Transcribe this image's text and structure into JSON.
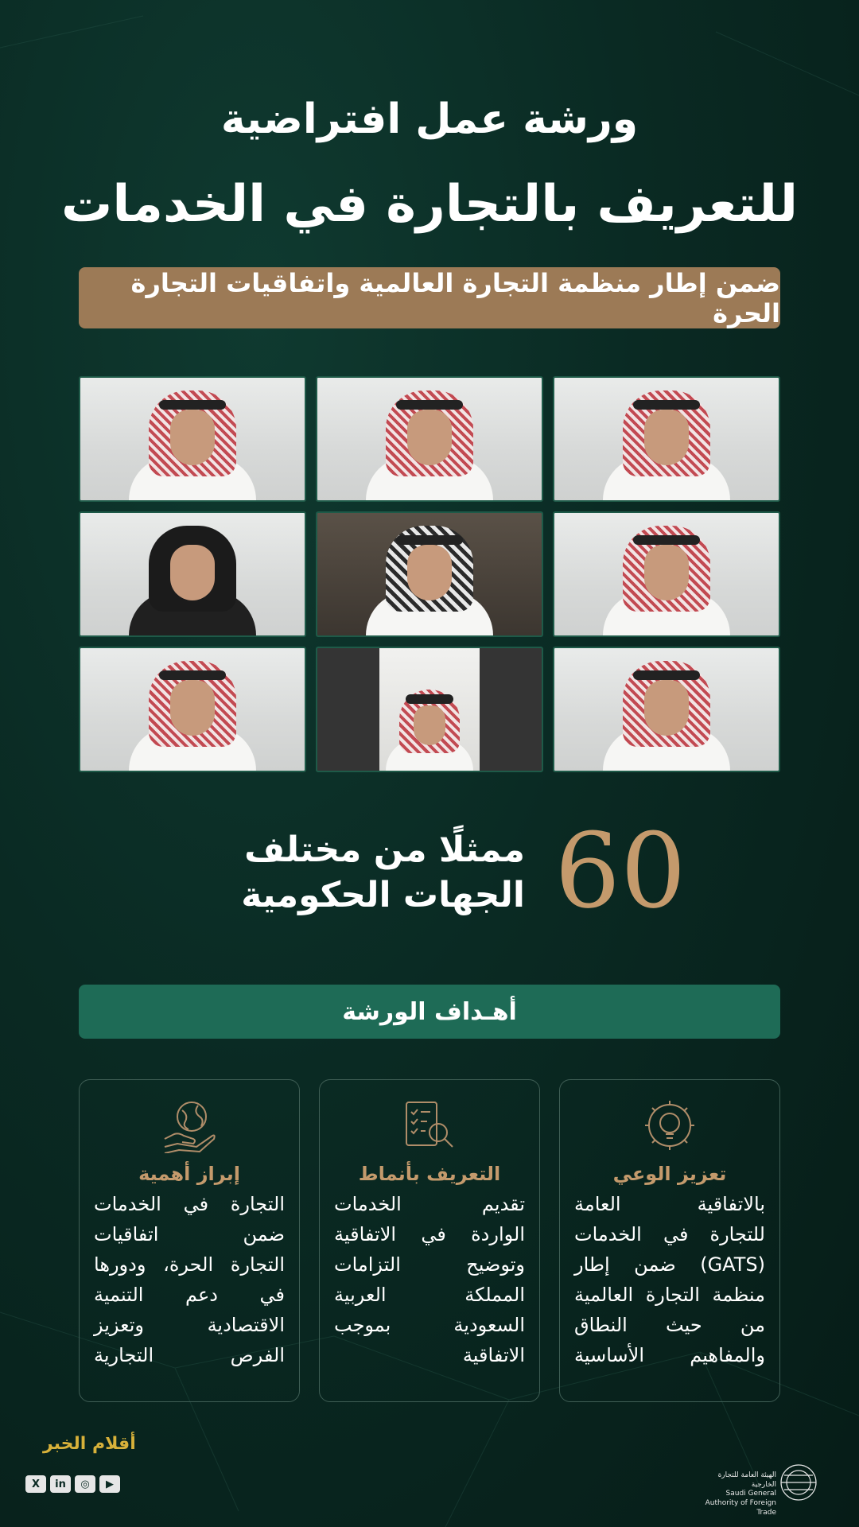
{
  "header": {
    "line1": "ورشة عمل افتراضية",
    "line2": "للتعريف بالتجارة في الخدمات",
    "subtitle": "ضمن إطار منظمة التجارة العالمية واتفاقيات التجارة الحرة"
  },
  "stat": {
    "number": "60",
    "line1": "ممثلًا من مختلف",
    "line2": "الجهات الحكومية"
  },
  "goals_title": "أهـداف الورشة",
  "cards": [
    {
      "icon": "lightbulb-gear-icon",
      "title": "تعزيز الوعي",
      "lines": [
        "بالاتفاقية العامة",
        "للتجارة في الخدمات",
        "(GATS) ضمن إطار",
        "منظمة التجارة العالمية",
        "من حيث النطاق",
        "والمفاهيم الأساسية"
      ]
    },
    {
      "icon": "checklist-search-icon",
      "title": "التعريف بأنماط",
      "lines": [
        "تقديم الخدمات",
        "الواردة في الاتفاقية",
        "وتوضيح التزامات",
        "المملكة العربية",
        "السعودية بموجب",
        "الاتفاقية"
      ]
    },
    {
      "icon": "globe-hand-icon",
      "title": "إبراز أهمية",
      "lines": [
        "التجارة في الخدمات",
        "ضمن اتفاقيات",
        "التجارة الحرة، ودورها",
        "في دعم التنمية",
        "الاقتصادية وتعزيز",
        "الفرص التجارية"
      ]
    }
  ],
  "footer": {
    "org_ar": "الهيئة العامة للتجارة الخارجية",
    "org_en": "Saudi General Authority of Foreign Trade",
    "watermark": "أقلام الخبر",
    "socials": [
      "X",
      "in",
      "◎",
      "▶"
    ]
  }
}
